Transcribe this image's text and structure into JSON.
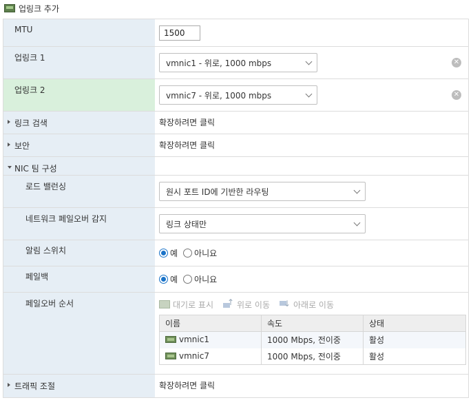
{
  "header": {
    "title": "업링크 추가",
    "icon": "network-adapter-icon"
  },
  "mtu": {
    "label": "MTU",
    "value": "1500"
  },
  "uplink1": {
    "label": "업링크 1",
    "value": "vmnic1 - 위로, 1000 mbps"
  },
  "uplink2": {
    "label": "업링크 2",
    "value": "vmnic7 - 위로, 1000 mbps"
  },
  "link_discovery": {
    "label": "링크 검색",
    "value": "확장하려면 클릭"
  },
  "security": {
    "label": "보안",
    "value": "확장하려면 클릭"
  },
  "nic_teaming": {
    "label": "NIC 팀 구성"
  },
  "load_balancing": {
    "label": "로드 밸런싱",
    "value": "원시 포트 ID에 기반한 라우팅"
  },
  "failover_detection": {
    "label": "네트워크 페일오버 감지",
    "value": "링크 상태만"
  },
  "notify_switches": {
    "label": "알림 스위치",
    "yes": "예",
    "no": "아니요",
    "selected": "yes"
  },
  "failback": {
    "label": "페일백",
    "yes": "예",
    "no": "아니요",
    "selected": "yes"
  },
  "failover_order": {
    "label": "페일오버 순서",
    "toolbar": {
      "standby": "대기로 표시",
      "move_up": "위로 이동",
      "move_down": "아래로 이동"
    },
    "columns": [
      "이름",
      "속도",
      "상태"
    ],
    "rows": [
      {
        "name": "vmnic1",
        "speed": "1000 Mbps, 전이중",
        "status": "활성"
      },
      {
        "name": "vmnic7",
        "speed": "1000 Mbps, 전이중",
        "status": "활성"
      }
    ]
  },
  "traffic_shaping": {
    "label": "트래픽 조절",
    "value": "확장하려면 클릭"
  },
  "colors": {
    "label_bg": "#e6eef5",
    "highlight_bg": "#d9f0dc",
    "radio_accent": "#1a73c8"
  }
}
